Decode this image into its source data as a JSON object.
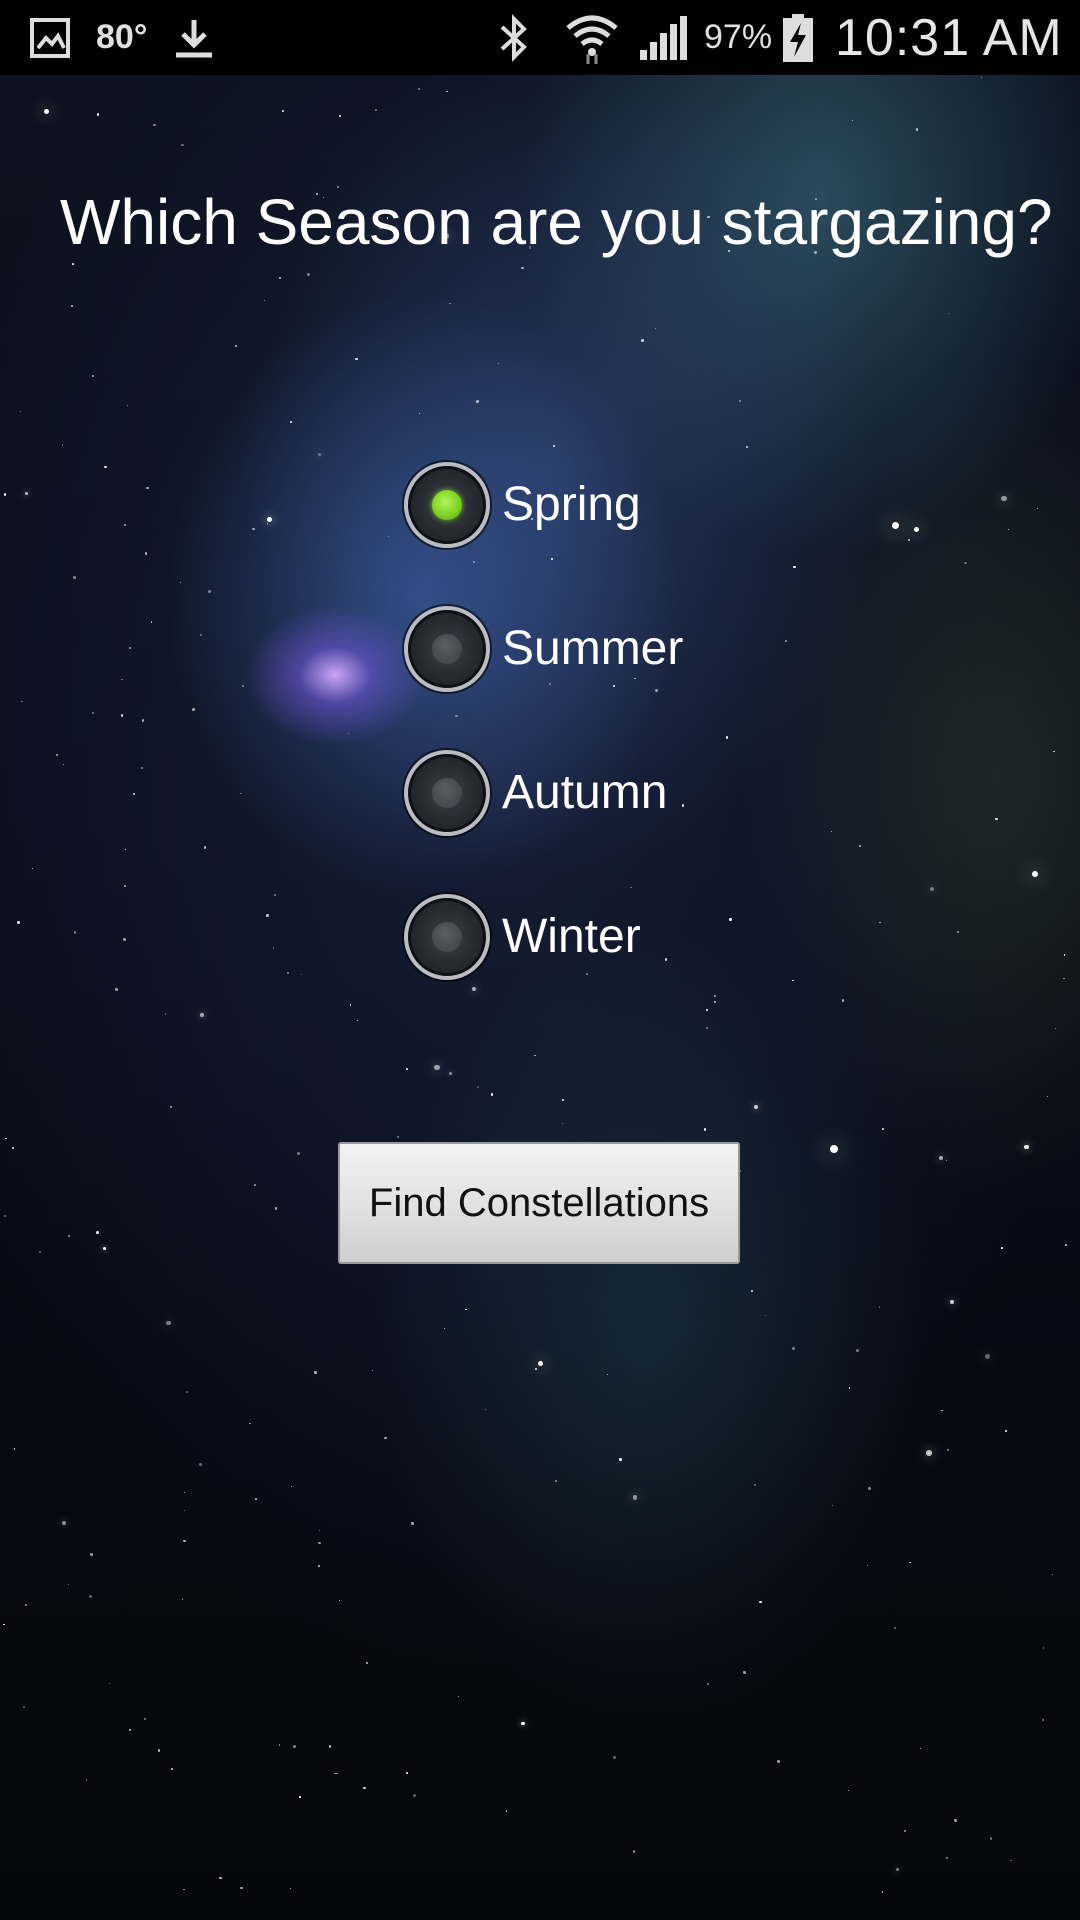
{
  "status_bar": {
    "temperature": "80°",
    "battery_percent": "97%",
    "time": "10:31 AM",
    "icons": [
      "gallery-icon",
      "download-icon",
      "bluetooth-icon",
      "wifi-icon",
      "signal-icon",
      "battery-charging-icon"
    ]
  },
  "title": "Which Season are you stargazing?",
  "seasons": [
    {
      "label": "Spring",
      "checked": true
    },
    {
      "label": "Summer",
      "checked": false
    },
    {
      "label": "Autumn",
      "checked": false
    },
    {
      "label": "Winter",
      "checked": false
    }
  ],
  "button": {
    "label": "Find Constellations"
  },
  "colors": {
    "selected_radio": "#7ed321",
    "status_bar_bg": "#000000",
    "title_text": "#ffffff",
    "button_bg": "#e2e2e2"
  }
}
